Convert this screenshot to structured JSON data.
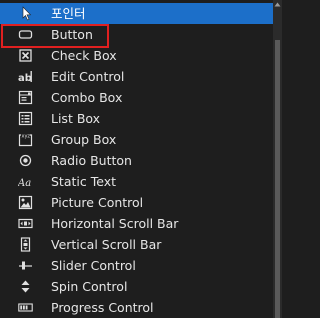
{
  "toolbox": {
    "items": [
      {
        "label": "포인터",
        "icon": "pointer-icon"
      },
      {
        "label": "Button",
        "icon": "button-icon"
      },
      {
        "label": "Check Box",
        "icon": "checkbox-icon"
      },
      {
        "label": "Edit Control",
        "icon": "edit-control-icon"
      },
      {
        "label": "Combo Box",
        "icon": "combo-box-icon"
      },
      {
        "label": "List Box",
        "icon": "list-box-icon"
      },
      {
        "label": "Group Box",
        "icon": "group-box-icon"
      },
      {
        "label": "Radio Button",
        "icon": "radio-button-icon"
      },
      {
        "label": "Static Text",
        "icon": "static-text-icon"
      },
      {
        "label": "Picture Control",
        "icon": "picture-control-icon"
      },
      {
        "label": "Horizontal Scroll Bar",
        "icon": "horizontal-scroll-bar-icon"
      },
      {
        "label": "Vertical Scroll Bar",
        "icon": "vertical-scroll-bar-icon"
      },
      {
        "label": "Slider Control",
        "icon": "slider-control-icon"
      },
      {
        "label": "Spin Control",
        "icon": "spin-control-icon"
      },
      {
        "label": "Progress Control",
        "icon": "progress-control-icon"
      }
    ]
  },
  "colors": {
    "background": "#1e1e1e",
    "selected_background": "#1c6fc9",
    "highlight_border": "#e02020",
    "text": "#e6e6e6"
  }
}
